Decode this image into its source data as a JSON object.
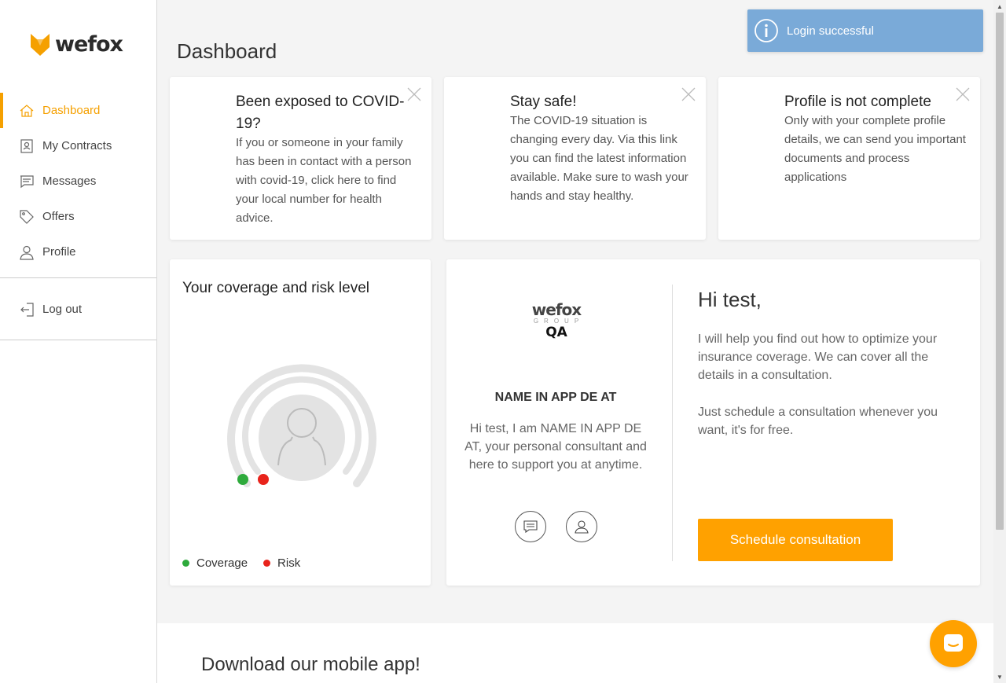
{
  "brand": {
    "name": "wefox",
    "accent": "#f5a000"
  },
  "sidebar": {
    "items": [
      {
        "label": "Dashboard",
        "icon": "home-icon",
        "active": true
      },
      {
        "label": "My Contracts",
        "icon": "contract-icon"
      },
      {
        "label": "Messages",
        "icon": "messages-icon"
      },
      {
        "label": "Offers",
        "icon": "tag-icon"
      },
      {
        "label": "Profile",
        "icon": "user-icon"
      }
    ],
    "logout": {
      "label": "Log out",
      "icon": "logout-icon"
    }
  },
  "main": {
    "title": "Dashboard"
  },
  "cards": [
    {
      "title": "Been exposed to COVID-19?",
      "body": "If you or someone in your family has been in contact with a person with covid-19, click here to find your local number for health advice."
    },
    {
      "title": "Stay safe!",
      "body": "The COVID-19 situation is changing every day. Via this link you can find the latest information available. Make sure to wash your hands and stay healthy."
    },
    {
      "title": "Profile is not complete",
      "body": "Only with your complete profile details, we can send you important documents and process applications"
    }
  ],
  "coverage": {
    "title": "Your coverage and risk level",
    "legend": {
      "coverage": "Coverage",
      "risk": "Risk"
    },
    "colors": {
      "coverage": "#2eaa3c",
      "risk": "#e8231b"
    }
  },
  "consultant": {
    "logo": {
      "name": "wefox",
      "group": "GROUP",
      "qa": "QA"
    },
    "name": "NAME IN APP DE AT",
    "description": "Hi test, I am NAME IN APP DE AT, your personal consultant and here to support you at anytime.",
    "greeting": "Hi test,",
    "paragraph1": "I will help you find out how to optimize your insurance coverage. We can cover all the details in a consultation.",
    "paragraph2": "Just schedule a consultation whenever you want, it's for free.",
    "button": "Schedule consultation"
  },
  "download": {
    "title": "Download our mobile app!"
  },
  "toast": {
    "message": "Login successful",
    "color": "#7aaad8"
  }
}
